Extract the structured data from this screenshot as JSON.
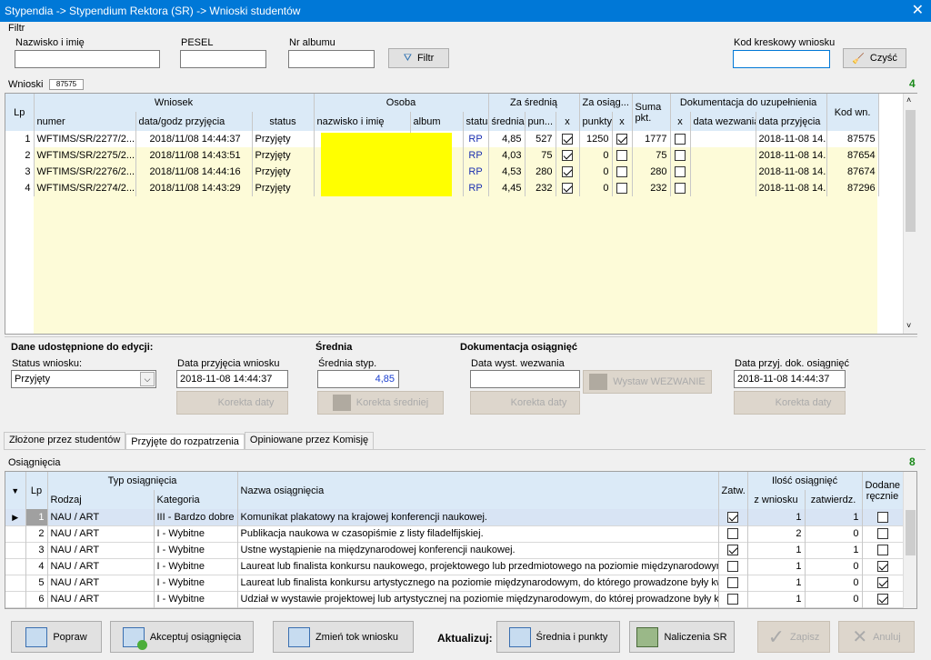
{
  "window": {
    "title": "Stypendia -> Stypendium Rektora (SR) -> Wnioski studentów",
    "close": "✕"
  },
  "filter": {
    "label": "Filtr",
    "name_label": "Nazwisko i imię",
    "pesel_label": "PESEL",
    "album_label": "Nr albumu",
    "filter_button": "Filtr",
    "barcode_label": "Kod kreskowy wniosku",
    "clear_button": "Czyść"
  },
  "wnioski": {
    "label": "Wnioski",
    "count": "87575",
    "total": "4",
    "group_headers": {
      "wniosek": "Wniosek",
      "osoba": "Osoba",
      "za_srednia": "Za średnią",
      "za_osiag": "Za osiąg...",
      "suma": "Suma pkt.",
      "dokumentacja": "Dokumentacja do uzupełnienia",
      "kod": "Kod wn.",
      "lp": "Lp"
    },
    "col_headers": {
      "numer": "numer",
      "data": "data/godz przyjęcia",
      "status": "status",
      "nazwisko": "nazwisko i imię",
      "album": "album",
      "ostatus": "status",
      "srednia": "średnia",
      "pun": "pun...",
      "x1": "x",
      "punkty": "punkty",
      "x2": "x",
      "dx": "x",
      "data_wezwania": "data wezwania",
      "data_przyjecia": "data przyjęcia"
    },
    "rows": [
      {
        "lp": "1",
        "numer": "WFTIMS/SR/2277/2...",
        "data": "2018/11/08 14:44:37",
        "status": "Przyjęty",
        "ostatus": "RP",
        "srednia": "4,85",
        "pun": "527",
        "x1": true,
        "punkty": "1250",
        "x2": true,
        "suma": "1777",
        "dx": false,
        "data_przyjecia": "2018-11-08 14...",
        "kod": "87575"
      },
      {
        "lp": "2",
        "numer": "WFTIMS/SR/2275/2...",
        "data": "2018/11/08 14:43:51",
        "status": "Przyjęty",
        "ostatus": "RP",
        "srednia": "4,03",
        "pun": "75",
        "x1": true,
        "punkty": "0",
        "x2": false,
        "suma": "75",
        "dx": false,
        "data_przyjecia": "2018-11-08 14...",
        "kod": "87654"
      },
      {
        "lp": "3",
        "numer": "WFTIMS/SR/2276/2...",
        "data": "2018/11/08 14:44:16",
        "status": "Przyjęty",
        "ostatus": "RP",
        "srednia": "4,53",
        "pun": "280",
        "x1": true,
        "punkty": "0",
        "x2": false,
        "suma": "280",
        "dx": false,
        "data_przyjecia": "2018-11-08 14...",
        "kod": "87674"
      },
      {
        "lp": "4",
        "numer": "WFTIMS/SR/2274/2...",
        "data": "2018/11/08 14:43:29",
        "status": "Przyjęty",
        "ostatus": "RP",
        "srednia": "4,45",
        "pun": "232",
        "x1": true,
        "punkty": "0",
        "x2": false,
        "suma": "232",
        "dx": false,
        "data_przyjecia": "2018-11-08 14...",
        "kod": "87296"
      }
    ]
  },
  "edit": {
    "title": "Dane udostępnione do edycji:",
    "status_label": "Status wniosku:",
    "status_value": "Przyjęty",
    "date_label": "Data przyjęcia wniosku",
    "date_value": "2018-11-08 14:44:37",
    "korekta_daty": "Korekta daty",
    "srednia_title": "Średnia",
    "srednia_label": "Średnia styp.",
    "srednia_value": "4,85",
    "korekta_sredniej": "Korekta średniej",
    "dok_title": "Dokumentacja osiągnięć",
    "wezwanie_label": "Data wyst. wezwania",
    "wezwanie_value": "",
    "wystaw": "Wystaw WEZWANIE",
    "korekta_daty2": "Korekta daty",
    "dok_date_label": "Data przyj. dok. osiągnięć",
    "dok_date_value": "2018-11-08 14:44:37",
    "korekta_daty3": "Korekta daty"
  },
  "tabs": [
    "Złożone przez studentów",
    "Przyjęte do rozpatrzenia",
    "Opiniowane przez Komisję"
  ],
  "osiagniecia": {
    "label": "Osiągnięcia",
    "total": "8",
    "headers": {
      "lp": "Lp",
      "typ": "Typ osiągnięcia",
      "rodzaj": "Rodzaj",
      "kategoria": "Kategoria",
      "nazwa": "Nazwa osiągnięcia",
      "zatw": "Zatw.",
      "ilosc": "Ilość osiągnięć",
      "z_wniosku": "z wniosku",
      "zatwierdz": "zatwierdz.",
      "dodane": "Dodane ręcznie"
    },
    "rows": [
      {
        "lp": "1",
        "rodzaj": "NAU / ART",
        "kategoria": "III - Bardzo dobre",
        "nazwa": "Komunikat plakatowy na krajowej konferencji naukowej.",
        "zatw": true,
        "z": "1",
        "zt": "1",
        "dod": false
      },
      {
        "lp": "2",
        "rodzaj": "NAU / ART",
        "kategoria": "I - Wybitne",
        "nazwa": "Publikacja naukowa w czasopiśmie z listy filadelfijskiej.",
        "zatw": false,
        "z": "2",
        "zt": "0",
        "dod": false
      },
      {
        "lp": "3",
        "rodzaj": "NAU / ART",
        "kategoria": "I - Wybitne",
        "nazwa": "Ustne wystąpienie na międzynarodowej konferencji naukowej.",
        "zatw": true,
        "z": "1",
        "zt": "1",
        "dod": false
      },
      {
        "lp": "4",
        "rodzaj": "NAU / ART",
        "kategoria": "I - Wybitne",
        "nazwa": "Laureat lub finalista konkursu naukowego, projektowego lub przedmiotowego na poziomie międzynarodowym.",
        "zatw": false,
        "z": "1",
        "zt": "0",
        "dod": true
      },
      {
        "lp": "5",
        "rodzaj": "NAU / ART",
        "kategoria": "I - Wybitne",
        "nazwa": "Laureat lub finalista konkursu artystycznego na poziomie międzynarodowym, do którego prowadzone były kwalifikac...",
        "zatw": false,
        "z": "1",
        "zt": "0",
        "dod": true
      },
      {
        "lp": "6",
        "rodzaj": "NAU / ART",
        "kategoria": "I - Wybitne",
        "nazwa": "Udział w wystawie projektowej lub artystycznej na poziomie międzynarodowym, do której prowadzone były kwalifika...",
        "zatw": false,
        "z": "1",
        "zt": "0",
        "dod": true
      }
    ]
  },
  "bottom": {
    "popraw": "Popraw",
    "akceptuj": "Akceptuj osiągnięcia",
    "zmien": "Zmień tok wniosku",
    "aktualizuj": "Aktualizuj:",
    "srednia_punkty": "Średnia i punkty",
    "naliczenia": "Naliczenia SR",
    "zapisz": "Zapisz",
    "anuluj": "Anuluj"
  }
}
